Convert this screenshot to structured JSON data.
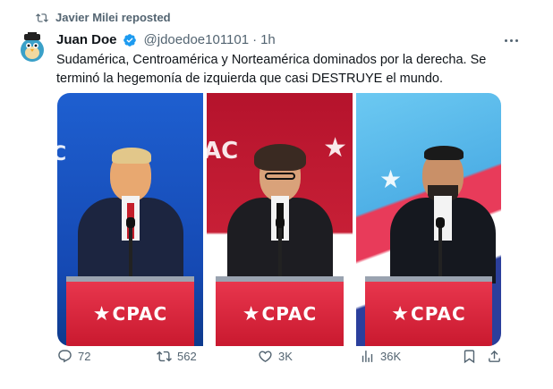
{
  "repost": {
    "icon": "repost-icon",
    "text": "Javier Milei reposted"
  },
  "author": {
    "name": "Juan Doe",
    "handle": "@jdoedoe101101",
    "separator": "·",
    "time": "1h",
    "verified": true,
    "verified_color": "#1d9bf0"
  },
  "tweet": {
    "text": "Sudamérica, Centroamérica y Norteamérica dominados por la derecha. Se terminó la hegemonía de izquierda que casi DESTRUYE el mundo."
  },
  "media": {
    "podium_label": "CPAC",
    "backdrop_label": "CPAC"
  },
  "actions": {
    "replies": "72",
    "reposts": "562",
    "likes": "3K",
    "views": "36K"
  },
  "colors": {
    "text_primary": "#0f1419",
    "text_secondary": "#536471",
    "brand_blue": "#1d9bf0",
    "cpac_red": "#c9192f"
  }
}
